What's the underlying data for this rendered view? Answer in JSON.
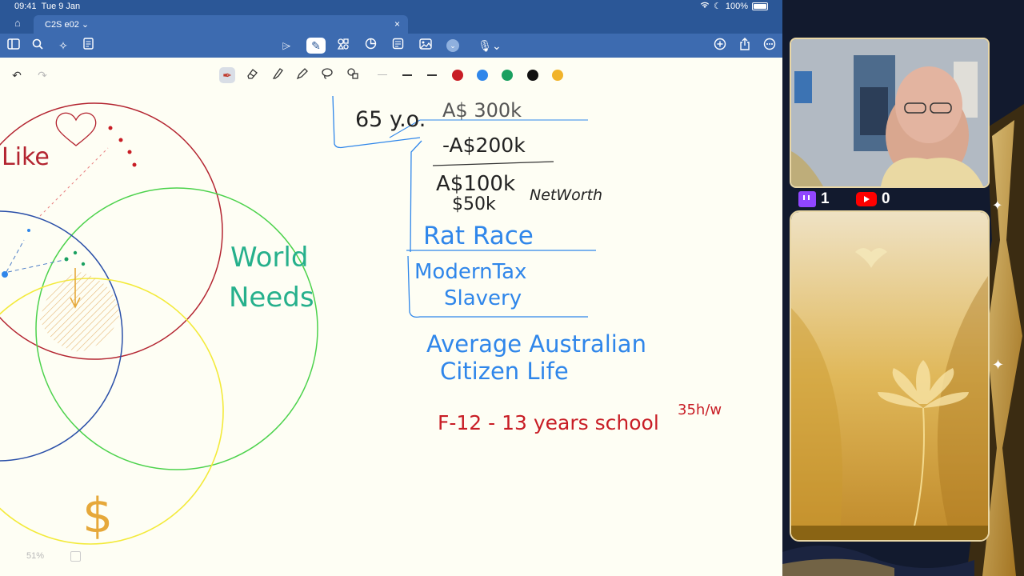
{
  "status": {
    "time": "09:41",
    "date": "Tue 9 Jan",
    "battery": "100%"
  },
  "tab": {
    "name": "C2S e02",
    "close": "×",
    "chevron": "⌄"
  },
  "toolbar": {
    "left_icons": [
      "sidebar-icon",
      "search-icon",
      "sparkle-icon",
      "page-icon"
    ],
    "right_icons": [
      "tag-icon",
      "pen-icon",
      "shapes-icon",
      "sticker-icon",
      "text-icon",
      "image-icon",
      "more-circle-icon",
      "mic-icon"
    ],
    "far_right_icons": [
      "plus-icon",
      "share-icon",
      "ellipsis-icon"
    ]
  },
  "pen_tools": {
    "undo": "↶",
    "redo": "↷",
    "tools": [
      "fountain-pen",
      "eraser",
      "highlighter",
      "pencil",
      "lasso",
      "shapes"
    ],
    "colors": [
      "#c81d25",
      "#2f86ea",
      "#1aa060",
      "#111111",
      "#f1b32a"
    ]
  },
  "canvas": {
    "venn_labels": {
      "like": "Like",
      "world": "World",
      "needs": "Needs",
      "dollar": "$"
    },
    "notes": {
      "age": "65 y.o.",
      "amount_300": "A$ 300k",
      "amount_200": "-A$200k",
      "amount_100": "A$100k",
      "amount_50": "$50k",
      "networth": "NetWorth",
      "rat_race": "Rat Race",
      "modern_tax": "ModernTax",
      "slavery": "Slavery",
      "average_australian": "Average Australian",
      "citizen_life": "Citizen Life",
      "school": "F-12  -  13 years school",
      "hours": "35h/w"
    },
    "colors": {
      "red": "#b32430",
      "blue": "#2f86ea",
      "green": "#26b08c",
      "yellow": "#f3ea3a",
      "orange": "#e6a83a"
    }
  },
  "zoom": "51%",
  "stream": {
    "twitch_count": "1",
    "youtube_count": "0"
  }
}
